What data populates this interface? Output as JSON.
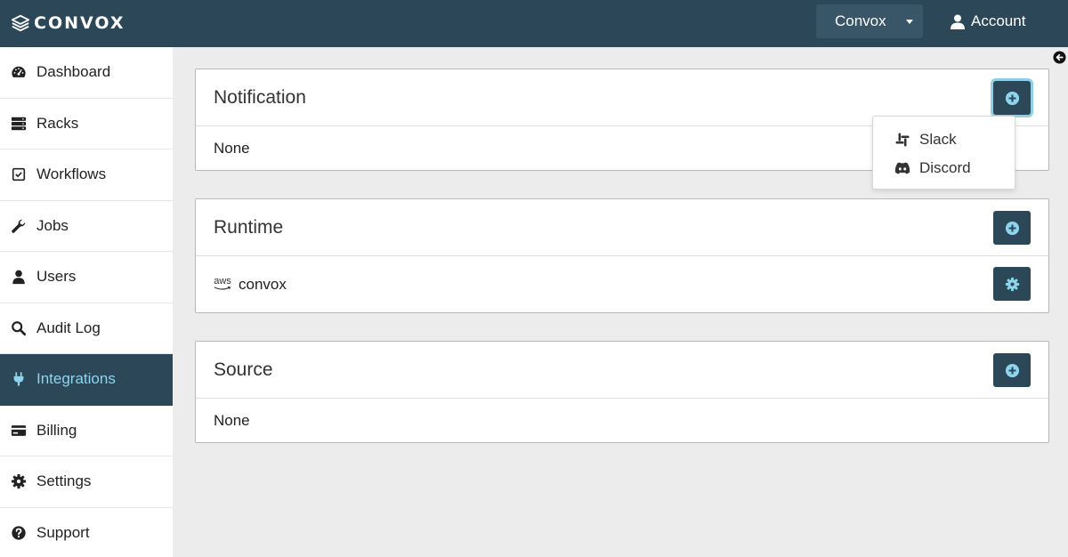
{
  "app": {
    "logo_text": "CONVOX"
  },
  "header": {
    "org_name": "Convox",
    "account_label": "Account"
  },
  "sidebar": {
    "active": "Integrations",
    "items": [
      {
        "label": "Dashboard",
        "icon": "dashboard-icon"
      },
      {
        "label": "Racks",
        "icon": "server-icon"
      },
      {
        "label": "Workflows",
        "icon": "checkbox-icon"
      },
      {
        "label": "Jobs",
        "icon": "wrench-icon"
      },
      {
        "label": "Users",
        "icon": "user-icon"
      },
      {
        "label": "Audit Log",
        "icon": "search-icon"
      },
      {
        "label": "Integrations",
        "icon": "plug-icon"
      },
      {
        "label": "Billing",
        "icon": "credit-card-icon"
      },
      {
        "label": "Settings",
        "icon": "gear-icon"
      },
      {
        "label": "Support",
        "icon": "question-circle-icon"
      }
    ]
  },
  "notification": {
    "title": "Notification",
    "body": "None",
    "menu": [
      {
        "label": "Slack",
        "icon": "slack-icon"
      },
      {
        "label": "Discord",
        "icon": "discord-icon"
      }
    ]
  },
  "runtime": {
    "title": "Runtime",
    "provider_logo": "aws",
    "entry": "convox"
  },
  "source": {
    "title": "Source",
    "body": "None"
  },
  "colors": {
    "topbar": "#2b4758",
    "accent": "#8fd4ee",
    "button": "#2b4758",
    "background": "#ececec"
  }
}
